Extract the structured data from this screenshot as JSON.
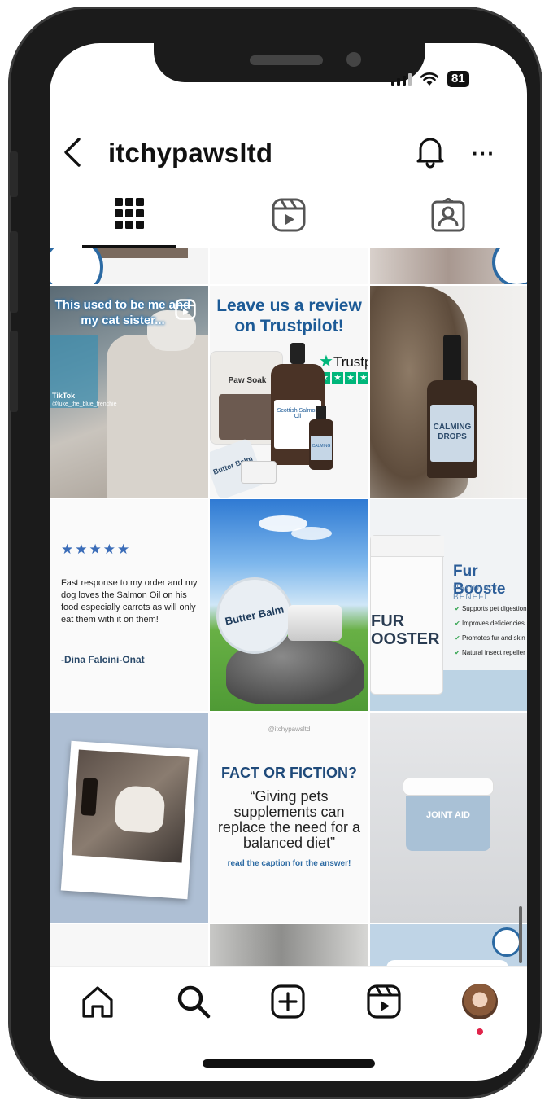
{
  "status": {
    "battery": "81"
  },
  "header": {
    "username": "itchypawsltd",
    "more": "···"
  },
  "tabs": [
    "grid",
    "reels",
    "tagged"
  ],
  "posts": {
    "tiktok": {
      "caption": "This used to be me and my cat sister...",
      "watermark": "TikTok",
      "handle": "@luke_the_blue_frenchie"
    },
    "trustpilot": {
      "line1": "Leave us a review",
      "line2": "on Trustpilot!",
      "brand": "Trustp",
      "paw_soak": "Paw Soak",
      "salmon_oil": "Scottish Salmon Oil",
      "butter_balm": "Butter Balm",
      "calming": "CALMING"
    },
    "calming_drops": {
      "label": "CALMING DROPS"
    },
    "review": {
      "stars": "★★★★★",
      "text": "Fast response to my order and my dog loves the Salmon Oil on his food especially carrots as will only eat them with it on them!",
      "author": "-Dina Falcini-Onat"
    },
    "butter_balm": {
      "label": "Butter Balm"
    },
    "fur_booster": {
      "title": "Fur Booste",
      "subtitle": "PRODUCT BENEFI",
      "jar_label": "FUR OOSTER",
      "benefits": [
        "Supports pet digestion",
        "Improves deficiencies",
        "Promotes fur and skin",
        "Natural insect repeller"
      ]
    },
    "fact": {
      "handle": "@itchypawsltd",
      "title": "FACT OR FICTION?",
      "quote": "“Giving pets supplements can replace the need for a balanced diet”",
      "footer": "read the caption for the answer!"
    },
    "joint_aid": {
      "label": "JOINT AID"
    }
  },
  "colors": {
    "brand_blue": "#1c5a96",
    "trustpilot_green": "#00b67a",
    "notification": "#e0244a"
  }
}
